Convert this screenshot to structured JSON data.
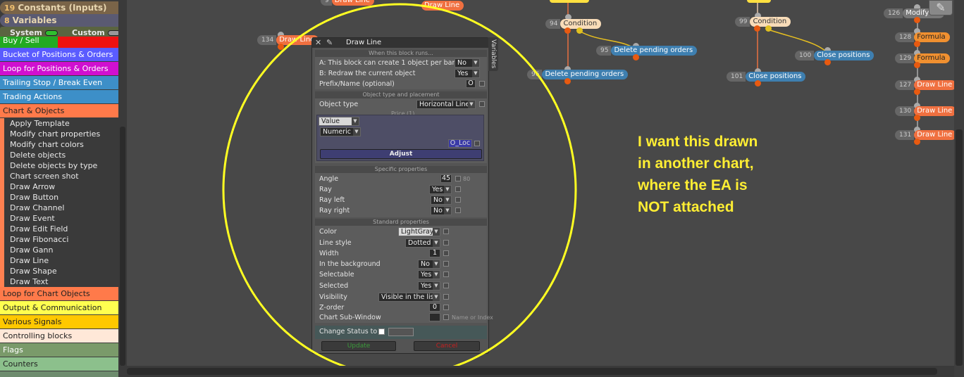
{
  "sidebar": {
    "constants": {
      "count": "19",
      "label": "Constants (Inputs)"
    },
    "variables": {
      "count": "8",
      "label": "Variables"
    },
    "toggles": {
      "system": "System",
      "custom": "Custom"
    },
    "categories": [
      {
        "label": "Buy / Sell",
        "color": "#22aa22"
      },
      {
        "label": "Bucket of Positions & Orders",
        "color": "#5a5cff"
      },
      {
        "label": "Loop for Positions & Orders",
        "color": "#d010d0"
      },
      {
        "label": "Trailing Stop / Break Even",
        "color": "#3d8fc8"
      },
      {
        "label": "Trading Actions",
        "color": "#3d8fc8"
      },
      {
        "label": "Chart & Objects",
        "color": "#ff7a4a"
      },
      {
        "label": "Loop for Chart Objects",
        "color": "#ff7a4a"
      },
      {
        "label": "Output & Communication",
        "color": "#ffff50"
      },
      {
        "label": "Various Signals",
        "color": "#ffc800"
      },
      {
        "label": "Controlling blocks",
        "color": "#ffe8d8"
      },
      {
        "label": "Flags",
        "color": "#7a9a6a"
      },
      {
        "label": "Counters",
        "color": "#8cc08c"
      }
    ],
    "chart_objects_items": [
      "Apply Template",
      "Modify chart properties",
      "Modify chart colors",
      "Delete objects",
      "Delete objects by type",
      "Chart screen shot",
      "Draw Arrow",
      "Draw Button",
      "Draw Channel",
      "Draw Event",
      "Draw Edit Field",
      "Draw Fibonacci",
      "Draw Gann",
      "Draw Line",
      "Draw Shape",
      "Draw Text"
    ]
  },
  "nodes": {
    "n_top1": "Draw Line",
    "n_top2": "Draw Line",
    "n134": {
      "id": "134",
      "label": "Draw Line"
    },
    "n94": {
      "id": "94",
      "label": "Condition"
    },
    "n95": {
      "id": "95",
      "label": "Delete pending orders"
    },
    "n_del2": {
      "id": "",
      "label": "Delete pending orders"
    },
    "n99": {
      "id": "99",
      "label": "Condition"
    },
    "n100": {
      "id": "100",
      "label": "Close positions"
    },
    "n101": {
      "id": "101",
      "label": "Close positions"
    },
    "n126": {
      "id": "126",
      "label": "Modify Va"
    },
    "n128": {
      "id": "128",
      "label": "Formula"
    },
    "n129": {
      "id": "129",
      "label": "Formula"
    },
    "n127": {
      "id": "127",
      "label": "Draw Line"
    },
    "n130": {
      "id": "130",
      "label": "Draw Line"
    },
    "n131": {
      "id": "131",
      "label": "Draw Line"
    }
  },
  "annotation": [
    "I want this drawn",
    "in another chart,",
    "where the EA is",
    "NOT attached"
  ],
  "dialog": {
    "title": "Draw Line",
    "variables_tab": "Variables",
    "sec_runs": "When this block runs...",
    "row_a": {
      "label": "A: This block can create 1 object per bar",
      "value": "No"
    },
    "row_b": {
      "label": "B: Redraw the current object",
      "value": "Yes"
    },
    "row_prefix": {
      "label": "Prefix/Name (optional)",
      "value": "O"
    },
    "sec_type": "Object type and placement",
    "object_type": {
      "label": "Object type",
      "value": "Horizontal Line"
    },
    "price_label": "Price (1)",
    "price_source": "Value",
    "price_kind": "Numeric",
    "price_var": "O_Loc",
    "adjust": "Adjust",
    "sec_specific": "Specific properties",
    "angle": {
      "label": "Angle",
      "value": "45",
      "hint": "80"
    },
    "ray": {
      "label": "Ray",
      "value": "Yes"
    },
    "ray_left": {
      "label": "Ray left",
      "value": "No"
    },
    "ray_right": {
      "label": "Ray right",
      "value": "No"
    },
    "sec_standard": "Standard properties",
    "color": {
      "label": "Color",
      "value": "LightGray"
    },
    "line_style": {
      "label": "Line style",
      "value": "Dotted"
    },
    "width": {
      "label": "Width",
      "value": "1"
    },
    "background": {
      "label": "In the background",
      "value": "No"
    },
    "selectable": {
      "label": "Selectable",
      "value": "Yes"
    },
    "selected": {
      "label": "Selected",
      "value": "Yes"
    },
    "visibility": {
      "label": "Visibility",
      "value": "Visible in the list"
    },
    "zorder": {
      "label": "Z-order",
      "value": "0"
    },
    "subwindow": {
      "label": "Chart Sub-Window",
      "value": "",
      "hint": "Name or Index"
    },
    "change_status": "Change Status to",
    "update": "Update",
    "cancel": "Cancel"
  }
}
